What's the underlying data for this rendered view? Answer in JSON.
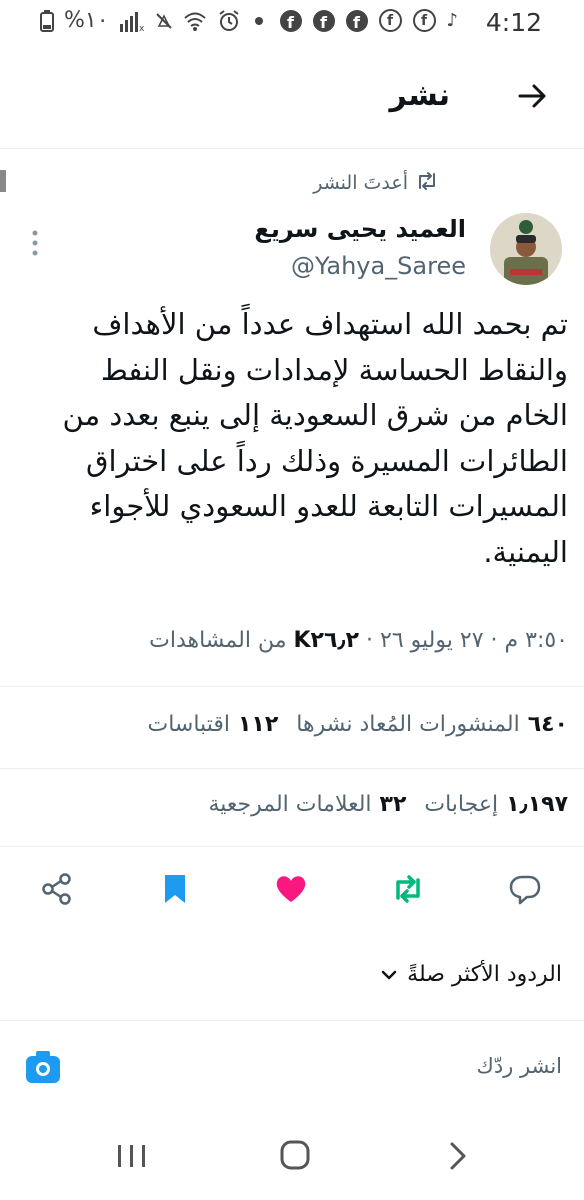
{
  "status_bar": {
    "time": "4:12",
    "battery": "%١٠",
    "icons": [
      "battery-icon",
      "signal-icon",
      "mute-icon",
      "wifi-icon",
      "alarm-icon",
      "dot-icon",
      "facebook-icon",
      "facebook-icon",
      "facebook-icon",
      "facebook-outline-icon",
      "facebook-outline-icon",
      "tiktok-icon"
    ]
  },
  "header": {
    "title": "نشر"
  },
  "repost": {
    "label": "أعدتَ النشر"
  },
  "author": {
    "name": "العميد يحيى سريع",
    "handle": "@Yahya_Saree"
  },
  "tweet": {
    "lines": [
      "تم بحمد الله استهداف عدداً من الأهداف",
      "والنقاط الحساسة لإمدادات ونقل النفط",
      "الخام من شرق السعودية إلى ينبع بعدد من",
      "الطائرات المسيرة وذلك رداً على اختراق",
      "المسيرات التابعة للعدو السعودي للأجواء",
      "اليمنية."
    ],
    "time": "٣:٥٠ م",
    "date": "٢٧ يوليو ٢٦",
    "views_count": "K٢٦٫٢",
    "views_label": "من المشاهدات"
  },
  "stats": {
    "reposts_count": "٦٤٠",
    "reposts_label": "المنشورات المُعاد نشرها",
    "quotes_count": "١١٢",
    "quotes_label": "اقتباسات",
    "likes_count": "١٫١٩٧",
    "likes_label": "إعجابات",
    "bookmarks_count": "٣٢",
    "bookmarks_label": "العلامات المرجعية"
  },
  "colors": {
    "like": "#f91880",
    "repost": "#00ba7c",
    "bookmark": "#1d9bf0",
    "camera": "#1d9bf0"
  },
  "replies": {
    "sort_label": "الردود الأكثر صلةً",
    "input_placeholder": "انشر ردّك"
  }
}
